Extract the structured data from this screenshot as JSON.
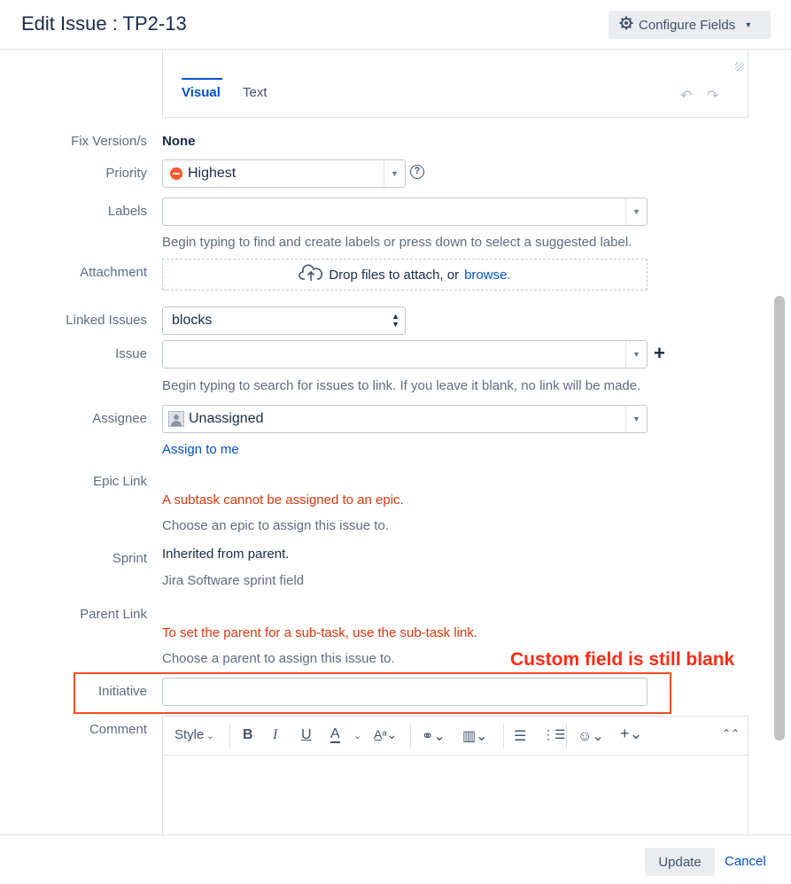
{
  "dialog": {
    "title": "Edit Issue : TP2-13",
    "configure_fields": "Configure Fields"
  },
  "editor": {
    "tab_visual": "Visual",
    "tab_text": "Text"
  },
  "fields": {
    "fix_version": {
      "label": "Fix Version/s",
      "value": "None"
    },
    "priority": {
      "label": "Priority",
      "value": "Highest",
      "help": "?"
    },
    "labels": {
      "label": "Labels",
      "value": "",
      "hint": "Begin typing to find and create labels or press down to select a suggested label."
    },
    "attachment": {
      "label": "Attachment",
      "drop_text": "Drop files to attach, or",
      "browse": "browse."
    },
    "linked_issues": {
      "label": "Linked Issues",
      "value": "blocks"
    },
    "issue": {
      "label": "Issue",
      "value": "",
      "add": "+",
      "hint": "Begin typing to search for issues to link. If you leave it blank, no link will be made."
    },
    "assignee": {
      "label": "Assignee",
      "value": "Unassigned",
      "assign_to_me": "Assign to me"
    },
    "epic_link": {
      "label": "Epic Link",
      "error": "A subtask cannot be assigned to an epic.",
      "hint": "Choose an epic to assign this issue to."
    },
    "sprint": {
      "label": "Sprint",
      "value": "Inherited from parent.",
      "hint": "Jira Software sprint field"
    },
    "parent_link": {
      "label": "Parent Link",
      "error": "To set the parent for a sub-task, use the sub-task link.",
      "hint": "Choose a parent to assign this issue to."
    },
    "initiative": {
      "label": "Initiative",
      "value": ""
    },
    "comment": {
      "label": "Comment",
      "style": "Style"
    }
  },
  "annotation": {
    "text": "Custom field is still blank",
    "color": "#ff2a14"
  },
  "footer": {
    "update": "Update",
    "cancel": "Cancel"
  },
  "colors": {
    "link": "#0052cc",
    "error": "#de350b",
    "priority_highest": "#ff5630"
  }
}
